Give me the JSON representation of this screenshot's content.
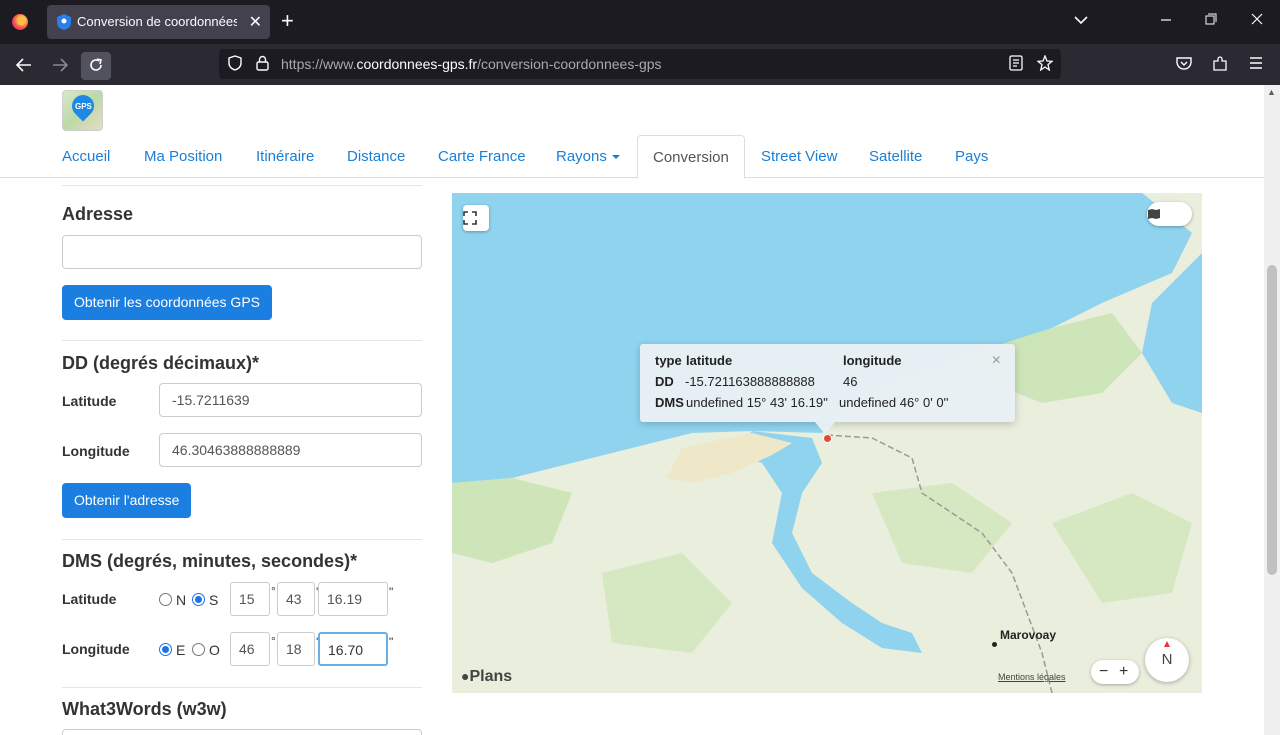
{
  "browser": {
    "tab_title": "Conversion de coordonnées GPS",
    "url_prefix": "https://www.",
    "url_host": "coordonnees-gps.fr",
    "url_path": "/conversion-coordonnees-gps",
    "new_tab": "+",
    "tab_close": "✕"
  },
  "site": {
    "logo_text": "GPS",
    "menu": [
      {
        "label": "Accueil"
      },
      {
        "label": "Ma Position"
      },
      {
        "label": "Itinéraire"
      },
      {
        "label": "Distance"
      },
      {
        "label": "Carte France"
      },
      {
        "label": "Rayons"
      },
      {
        "label": "Conversion"
      },
      {
        "label": "Street View"
      },
      {
        "label": "Satellite"
      },
      {
        "label": "Pays"
      }
    ]
  },
  "form": {
    "address_title": "Adresse",
    "address_value": "",
    "get_gps_button": "Obtenir les coordonnées GPS",
    "dd_title": "DD (degrés décimaux)*",
    "dd_lat_label": "Latitude",
    "dd_lat_value": "-15.7211639",
    "dd_lon_label": "Longitude",
    "dd_lon_value": "46.30463888888889",
    "get_address_button": "Obtenir l'adresse",
    "dms_title": "DMS (degrés, minutes, secondes)*",
    "dms_lat_label": "Latitude",
    "dms_lat_n": "N",
    "dms_lat_s": "S",
    "dms_lat_deg": "15",
    "dms_lat_min": "43",
    "dms_lat_sec": "16.19",
    "dms_lon_label": "Longitude",
    "dms_lon_e": "E",
    "dms_lon_o": "O",
    "dms_lon_deg": "46",
    "dms_lon_min": "18",
    "dms_lon_sec": "16.70",
    "deg_sym": "°",
    "min_sym": "'",
    "sec_sym": "\"",
    "w3w_title": "What3Words (w3w)"
  },
  "map": {
    "popup": {
      "h_type": "type",
      "h_lat": "latitude",
      "h_lon": "longitude",
      "dd_label": "DD",
      "dd_lat": "-15.721163888888888",
      "dd_lon": "46",
      "dms_label": "DMS",
      "dms_lat": "undefined 15° 43' 16.19''",
      "dms_lon": "undefined 46° 0' 0''",
      "close": "×"
    },
    "city": "Marovoay",
    "brand": "Plans",
    "legal": "Mentions légales",
    "compass": "N",
    "zoom_out": "−",
    "zoom_in": "+",
    "colors": {
      "water": "#8fd3ef",
      "land": "#e9eedd",
      "green": "#cde5b8"
    }
  }
}
